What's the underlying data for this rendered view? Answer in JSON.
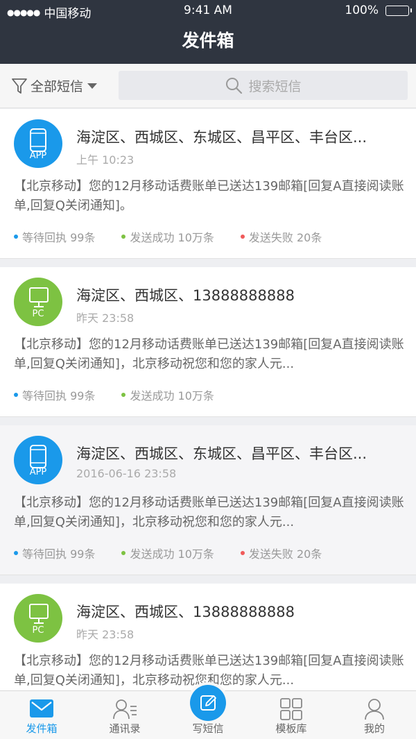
{
  "status": {
    "carrier": "中国移动",
    "time": "9:41 AM",
    "battery": "100%"
  },
  "header": {
    "title": "发件箱"
  },
  "filter": {
    "label": "全部短信",
    "search_placeholder": "搜索短信"
  },
  "messages": [
    {
      "source": "APP",
      "recipients": "海淀区、西城区、东城区、昌平区、丰台区...",
      "time": "上午 10:23",
      "body": "【北京移动】您的12月移动话费账单已送达139邮箱[回复A直接阅读账单,回复Q关闭通知]。",
      "stats": [
        {
          "label": "等待回执 99条",
          "color": "#1a99ea"
        },
        {
          "label": "发送成功 10万条",
          "color": "#7dc242"
        },
        {
          "label": "发送失败 20条",
          "color": "#f05a5a"
        }
      ]
    },
    {
      "source": "PC",
      "recipients": "海淀区、西城区、13888888888",
      "time": "昨天 23:58",
      "body": "【北京移动】您的12月移动话费账单已送达139邮箱[回复A直接阅读账单,回复Q关闭通知]，北京移动祝您和您的家人元...",
      "stats": [
        {
          "label": "等待回执 99条",
          "color": "#1a99ea"
        },
        {
          "label": "发送成功 10万条",
          "color": "#7dc242"
        }
      ]
    },
    {
      "source": "APP",
      "recipients": "海淀区、西城区、东城区、昌平区、丰台区...",
      "time": "2016-06-16 23:58",
      "body": "【北京移动】您的12月移动话费账单已送达139邮箱[回复A直接阅读账单,回复Q关闭通知]，北京移动祝您和您的家人元...",
      "stats": [
        {
          "label": "等待回执 99条",
          "color": "#1a99ea"
        },
        {
          "label": "发送成功 10万条",
          "color": "#7dc242"
        },
        {
          "label": "发送失败 20条",
          "color": "#f05a5a"
        }
      ]
    },
    {
      "source": "PC",
      "recipients": "海淀区、西城区、13888888888",
      "time": "昨天 23:58",
      "body": "【北京移动】您的12月移动话费账单已送达139邮箱[回复A直接阅读账单,回复Q关闭通知]，北京移动祝您和您的家人元...",
      "stats": []
    }
  ],
  "tabs": [
    {
      "label": "发件箱",
      "icon": "mail-icon"
    },
    {
      "label": "通讯录",
      "icon": "contacts-icon"
    },
    {
      "label": "写短信",
      "icon": "compose-icon"
    },
    {
      "label": "模板库",
      "icon": "grid-icon"
    },
    {
      "label": "我的",
      "icon": "user-icon"
    }
  ],
  "colors": {
    "accent": "#1a99ea",
    "pc": "#7dc242",
    "fail": "#f05a5a",
    "header": "#2f3540"
  }
}
